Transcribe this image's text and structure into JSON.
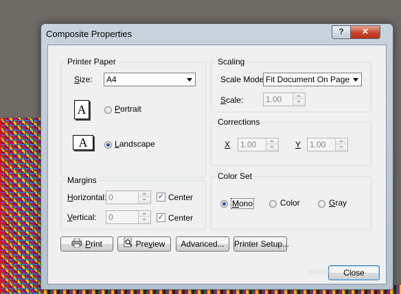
{
  "dialog": {
    "title": "Composite Properties",
    "help_label": "?",
    "close_glyph": "✕"
  },
  "printer_paper": {
    "legend": "Printer Paper",
    "size_label": "Size:",
    "size_value": "A4",
    "portrait_icon_letter": "A",
    "portrait_label": "Portrait",
    "landscape_icon_letter": "A",
    "landscape_label": "Landscape",
    "selected": "Landscape"
  },
  "margins": {
    "legend": "Margins",
    "horizontal_label": "Horizontal:",
    "horizontal_value": "0",
    "horizontal_center_label": "Center",
    "horizontal_center_checked": true,
    "vertical_label": "Vertical:",
    "vertical_value": "0",
    "vertical_center_label": "Center",
    "vertical_center_checked": true
  },
  "scaling": {
    "legend": "Scaling",
    "mode_label": "Scale Mode",
    "mode_value": "Fit Document On Page",
    "scale_label": "Scale:",
    "scale_value": "1.00"
  },
  "corrections": {
    "legend": "Corrections",
    "x_label": "X",
    "x_value": "1.00",
    "y_label": "Y",
    "y_value": "1.00"
  },
  "color_set": {
    "legend": "Color Set",
    "mono_label": "Mono",
    "color_label": "Color",
    "gray_label": "Gray",
    "selected": "Mono"
  },
  "buttons": {
    "print": "Print",
    "preview": "Preview",
    "advanced": "Advanced...",
    "printer_setup": "Printer Setup...",
    "close": "Close"
  },
  "watermark": "eworld"
}
